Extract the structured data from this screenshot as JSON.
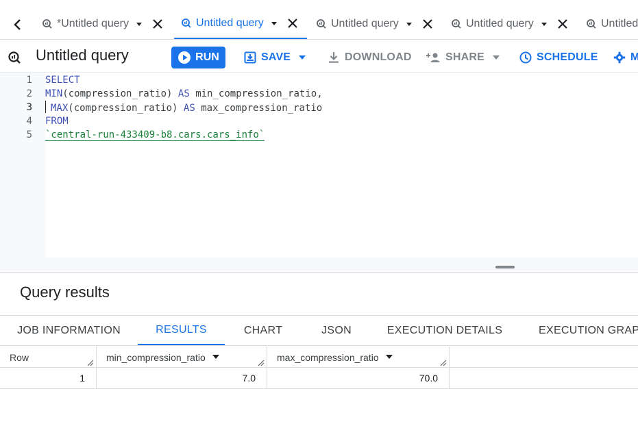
{
  "tabs": [
    {
      "label": "*Untitled query",
      "active": false
    },
    {
      "label": "Untitled query",
      "active": true
    },
    {
      "label": "Untitled query",
      "active": false
    },
    {
      "label": "Untitled query",
      "active": false
    },
    {
      "label": "Untitled",
      "active": false
    }
  ],
  "query": {
    "title": "Untitled query",
    "run_label": "RUN",
    "save_label": "SAVE",
    "download_label": "DOWNLOAD",
    "share_label": "SHARE",
    "schedule_label": "SCHEDULE",
    "more_label": "M"
  },
  "editor": {
    "line_numbers": [
      "1",
      "2",
      "3",
      "4",
      "5"
    ],
    "lines": {
      "l1_kw": "SELECT",
      "l2_fn": "MIN",
      "l2_args": "(compression_ratio)",
      "l2_as": "AS",
      "l2_alias": "min_compression_ratio,",
      "l3_fn": "MAX",
      "l3_args": "(compression_ratio)",
      "l3_as": "AS",
      "l3_alias": "max_compression_ratio",
      "l4_kw": "FROM",
      "l5_table": "`central-run-433409-b8.cars.cars_info`"
    }
  },
  "results": {
    "title": "Query results",
    "tabs": [
      "JOB INFORMATION",
      "RESULTS",
      "CHART",
      "JSON",
      "EXECUTION DETAILS",
      "EXECUTION GRAPH"
    ],
    "active_tab": "RESULTS",
    "columns": [
      "Row",
      "min_compression_ratio",
      "max_compression_ratio"
    ],
    "rows": [
      {
        "row": "1",
        "min": "7.0",
        "max": "70.0"
      }
    ]
  },
  "colors": {
    "accent": "#1a73e8",
    "keyword": "#3f51b5",
    "string": "#188038"
  }
}
